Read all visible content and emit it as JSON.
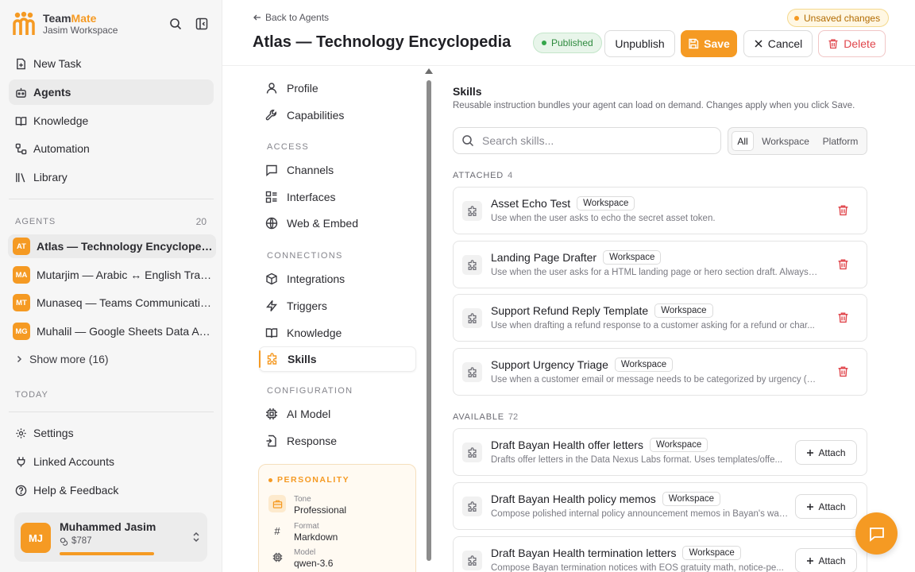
{
  "brand": {
    "name_part1": "Team",
    "name_part2": "Mate",
    "workspace": "Jasim Workspace"
  },
  "sidebar": {
    "nav": [
      {
        "label": "New Task",
        "icon": "new-task-icon"
      },
      {
        "label": "Agents",
        "icon": "agents-icon"
      },
      {
        "label": "Knowledge",
        "icon": "book-icon"
      },
      {
        "label": "Automation",
        "icon": "automation-icon"
      },
      {
        "label": "Library",
        "icon": "library-icon"
      }
    ],
    "agents_label": "AGENTS",
    "agents_count": "20",
    "agents": [
      {
        "initials": "AT",
        "name": "Atlas — Technology Encyclopedia"
      },
      {
        "initials": "MA",
        "name": "Mutarjim — Arabic ↔ English Translator"
      },
      {
        "initials": "MT",
        "name": "Munaseq — Teams Communications"
      },
      {
        "initials": "MG",
        "name": "Muhalil — Google Sheets Data Analyst"
      }
    ],
    "show_more": "Show more (16)",
    "today_label": "TODAY",
    "bottom_nav": [
      {
        "label": "Settings",
        "icon": "settings-icon"
      },
      {
        "label": "Linked Accounts",
        "icon": "plug-icon"
      },
      {
        "label": "Help & Feedback",
        "icon": "help-icon"
      }
    ],
    "user": {
      "initials": "MJ",
      "name": "Muhammed Jasim",
      "credit": "$787",
      "credit_fraction": 0.7
    }
  },
  "header": {
    "back": "Back to Agents",
    "title": "Atlas — Technology Encyclopedia",
    "unsaved": "Unsaved changes",
    "status": "Published",
    "unpublish": "Unpublish",
    "save": "Save",
    "cancel": "Cancel",
    "delete": "Delete"
  },
  "settings_nav": {
    "top": [
      {
        "label": "Profile",
        "icon": "user-icon"
      },
      {
        "label": "Capabilities",
        "icon": "wrench-icon"
      }
    ],
    "access_label": "ACCESS",
    "access": [
      {
        "label": "Channels",
        "icon": "chat-icon"
      },
      {
        "label": "Interfaces",
        "icon": "interfaces-icon"
      },
      {
        "label": "Web & Embed",
        "icon": "globe-icon"
      }
    ],
    "connections_label": "CONNECTIONS",
    "connections": [
      {
        "label": "Integrations",
        "icon": "cube-icon"
      },
      {
        "label": "Triggers",
        "icon": "bolt-icon"
      },
      {
        "label": "Knowledge",
        "icon": "book-icon"
      },
      {
        "label": "Skills",
        "icon": "puzzle-icon"
      }
    ],
    "configuration_label": "CONFIGURATION",
    "configuration": [
      {
        "label": "AI Model",
        "icon": "chip-icon"
      },
      {
        "label": "Response",
        "icon": "response-icon"
      }
    ],
    "personality": {
      "label": "PERSONALITY",
      "tone_k": "Tone",
      "tone_v": "Professional",
      "format_k": "Format",
      "format_v": "Markdown",
      "model_k": "Model",
      "model_v": "qwen-3.6"
    }
  },
  "skills": {
    "title": "Skills",
    "description": "Reusable instruction bundles your agent can load on demand. Changes apply when you click Save.",
    "search_placeholder": "Search skills...",
    "filters": [
      "All",
      "Workspace",
      "Platform"
    ],
    "attached_label": "ATTACHED",
    "attached_count": "4",
    "attached": [
      {
        "title": "Asset Echo Test",
        "badge": "Workspace",
        "desc": "Use when the user asks to echo the secret asset token."
      },
      {
        "title": "Landing Page Drafter",
        "badge": "Workspace",
        "desc": "Use when the user asks for a HTML landing page or hero section draft. Always r..."
      },
      {
        "title": "Support Refund Reply Template",
        "badge": "Workspace",
        "desc": "Use when drafting a refund response to a customer asking for a refund or char..."
      },
      {
        "title": "Support Urgency Triage",
        "badge": "Workspace",
        "desc": "Use when a customer email or message needs to be categorized by urgency (P..."
      }
    ],
    "available_label": "AVAILABLE",
    "available_count": "72",
    "attach_label": "Attach",
    "available": [
      {
        "title": "Draft Bayan Health offer letters",
        "badge": "Workspace",
        "desc": "Drafts offer letters in the Data Nexus Labs format. Uses templates/offe..."
      },
      {
        "title": "Draft Bayan Health policy memos",
        "badge": "Workspace",
        "desc": "Compose polished internal policy announcement memos in Bayan's war..."
      },
      {
        "title": "Draft Bayan Health termination letters",
        "badge": "Workspace",
        "desc": "Compose Bayan termination notices with EOS gratuity math, notice-pe..."
      }
    ]
  },
  "colors": {
    "accent": "#f59a23",
    "danger": "#e0454b",
    "success": "#2e8a3e"
  }
}
